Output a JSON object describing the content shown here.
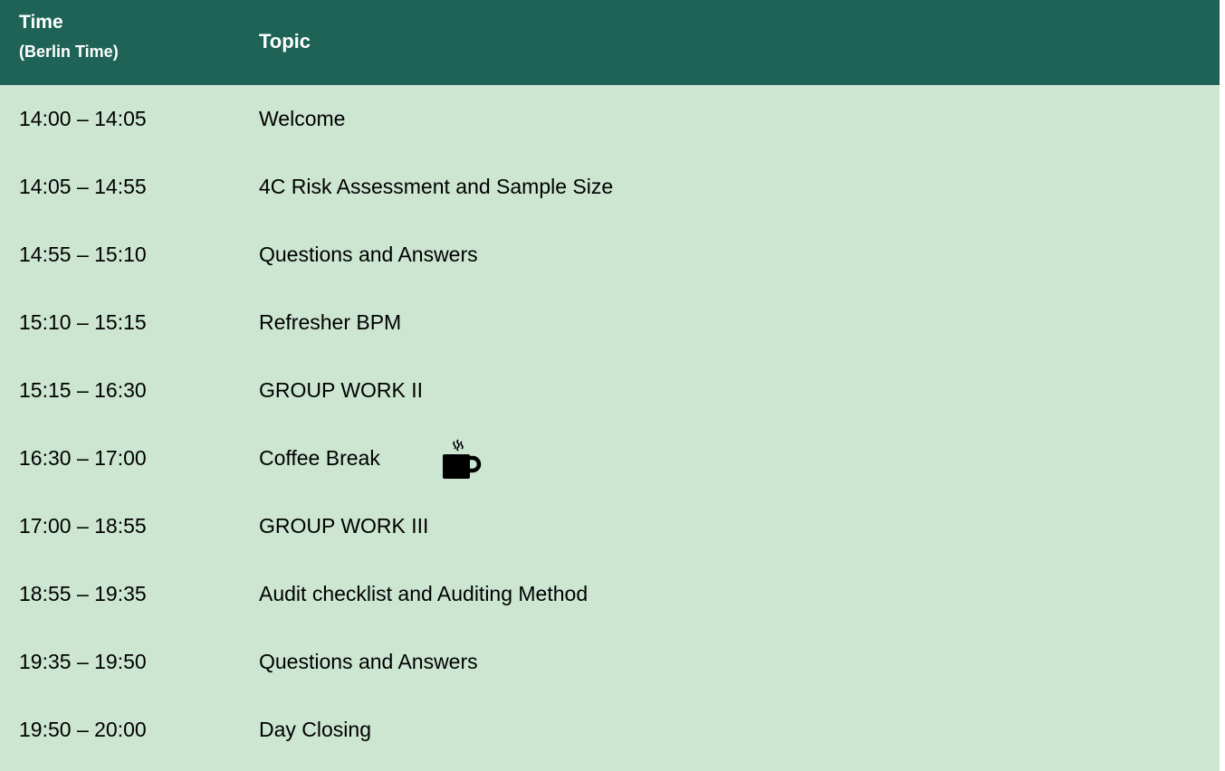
{
  "header": {
    "time_label": "Time",
    "time_sublabel": "(Berlin Time)",
    "topic_label": "Topic"
  },
  "colors": {
    "header_bg": "#1e6356",
    "body_bg": "#cce6d2"
  },
  "rows": [
    {
      "time": "14:00 – 14:05",
      "topic": "Welcome"
    },
    {
      "time": "14:05 – 14:55",
      "topic": "4C Risk Assessment and Sample Size"
    },
    {
      "time": "14:55 – 15:10",
      "topic": "Questions and Answers"
    },
    {
      "time": "15:10 – 15:15",
      "topic": "Refresher BPM"
    },
    {
      "time": "15:15 – 16:30",
      "topic": "GROUP WORK II"
    },
    {
      "time": "16:30 – 17:00",
      "topic": "Coffee Break",
      "icon": "coffee-cup-icon"
    },
    {
      "time": "17:00 – 18:55",
      "topic": "GROUP WORK III"
    },
    {
      "time": "18:55 – 19:35",
      "topic": "Audit checklist and Auditing Method"
    },
    {
      "time": "19:35 – 19:50",
      "topic": "Questions and Answers"
    },
    {
      "time": "19:50 – 20:00",
      "topic": "Day Closing"
    }
  ]
}
